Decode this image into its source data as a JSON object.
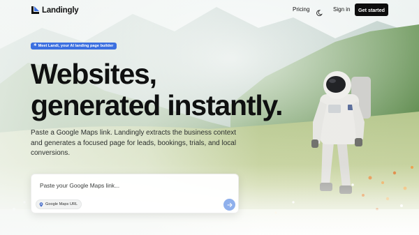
{
  "brand": {
    "name": "Landingly",
    "accent": "#3b6fe0"
  },
  "nav": {
    "pricing_label": "Pricing",
    "theme_icon": "moon-icon",
    "signin_label": "Sign in",
    "cta_label": "Get started"
  },
  "hero": {
    "badge_icon": "sparkle-icon",
    "badge_label": "Meet Landi, your AI landing page builder",
    "headline_line1": "Websites,",
    "headline_line2": "generated instantly.",
    "subtitle": "Paste a Google Maps link. Landingly extracts the business context and generates a focused page for leads, bookings, trials, and local conversions."
  },
  "prompt": {
    "placeholder": "Paste your Google Maps link...",
    "value": "",
    "chip_icon": "map-pin-icon",
    "chip_label": "Google Maps URL",
    "send_icon": "arrow-right-icon"
  },
  "colors": {
    "cta_background": "#0d0d0d",
    "send_button": "#8fb0ec"
  }
}
